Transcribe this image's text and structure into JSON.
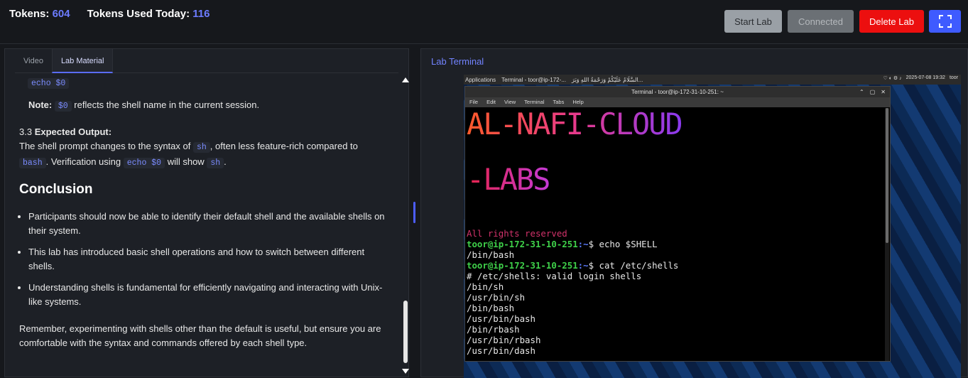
{
  "header": {
    "tokens_label": "Tokens:",
    "tokens_value": "604",
    "used_label": "Tokens Used Today:",
    "used_value": "116",
    "start_label": "Start Lab",
    "connected_label": "Connected",
    "delete_label": "Delete Lab",
    "fullscreen_icon": "⛶"
  },
  "tabs": [
    {
      "label": "Video"
    },
    {
      "label": "Lab Material"
    }
  ],
  "material": {
    "top_code": "echo $0",
    "note_label": "Note:",
    "note_code": "$0",
    "note_text": "reflects the shell name in the current session.",
    "section_num": "3.3",
    "section_title": "Expected Output:",
    "para_a": "The shell prompt changes to the syntax of",
    "code_sh": "sh",
    "para_b": ", often less feature-rich compared to",
    "code_bash": "bash",
    "para_c": ". Verification using",
    "code_echo": "echo $0",
    "para_d": "will show",
    "code_sh2": "sh",
    "para_e": ".",
    "conclusion": "Conclusion",
    "bullets": [
      "Participants should now be able to identify their default shell and the available shells on their system.",
      "This lab has introduced basic shell operations and how to switch between different shells.",
      "Understanding shells is fundamental for efficiently navigating and interacting with Unix-like systems."
    ],
    "remember": "Remember, experimenting with shells other than the default is useful, but ensure you are comfortable with the syntax and commands offered by each shell type."
  },
  "terminal_panel": {
    "title": "Lab Terminal"
  },
  "vm": {
    "applications": "Applications",
    "task_term": "Terminal - toor@ip-172-...",
    "arabic_text": "السَّلَامُ عَلَيْكُمْ وَرَحْمَةُ اللهِ وَبَرَ...",
    "date": "2025-07-08",
    "time": "19:32",
    "user": "toor",
    "term_title": "Terminal - toor@ip-172-31-10-251: ~",
    "menu": [
      "File",
      "Edit",
      "View",
      "Terminal",
      "Tabs",
      "Help"
    ],
    "banner1": "AL-NAFI-CLOUD",
    "banner2": "-LABS",
    "rights": "All rights reserved",
    "user_host": "toor@ip-172-31-10-251",
    "path": ":~",
    "cmd1": "$ echo $SHELL",
    "out1": "/bin/bash",
    "cmd2": "$ cat /etc/shells",
    "out2": [
      "# /etc/shells: valid login shells",
      "/bin/sh",
      "/usr/bin/sh",
      "/bin/bash",
      "/usr/bin/bash",
      "/bin/rbash",
      "/usr/bin/rbash",
      "/usr/bin/dash"
    ]
  }
}
